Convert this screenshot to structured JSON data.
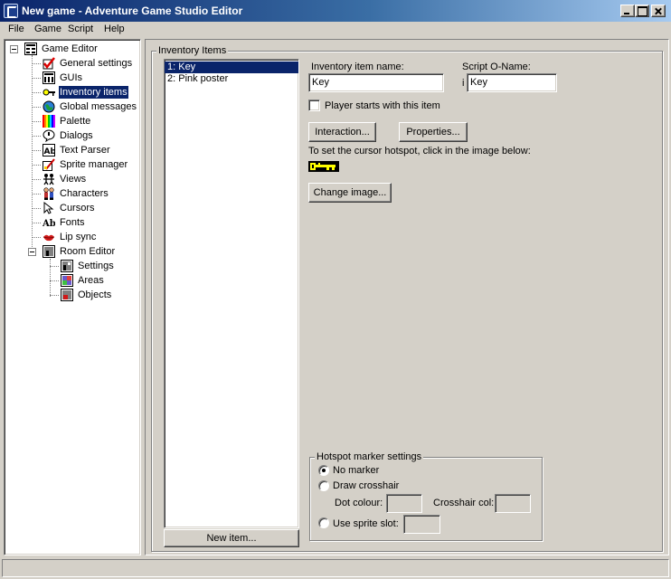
{
  "window": {
    "title": "New game - Adventure Game Studio Editor"
  },
  "menu": [
    "File",
    "Game",
    "Script",
    "Help"
  ],
  "tree": {
    "root_label": "Game Editor",
    "items": [
      {
        "label": "General settings",
        "icon": "checkmark-icon"
      },
      {
        "label": "GUIs",
        "icon": "gui-icon"
      },
      {
        "label": "Inventory items",
        "icon": "key-icon"
      },
      {
        "label": "Global messages",
        "icon": "globe-icon"
      },
      {
        "label": "Palette",
        "icon": "palette-icon"
      },
      {
        "label": "Dialogs",
        "icon": "dialog-icon"
      },
      {
        "label": "Text Parser",
        "icon": "text-parser-icon"
      },
      {
        "label": "Sprite manager",
        "icon": "sprite-icon"
      },
      {
        "label": "Views",
        "icon": "views-icon"
      },
      {
        "label": "Characters",
        "icon": "characters-icon"
      },
      {
        "label": "Cursors",
        "icon": "cursor-icon"
      },
      {
        "label": "Fonts",
        "icon": "font-icon"
      },
      {
        "label": "Lip sync",
        "icon": "lips-icon"
      }
    ],
    "selected": "Inventory items",
    "room_label": "Room Editor",
    "room_items": [
      {
        "label": "Settings",
        "icon": "room-settings-icon"
      },
      {
        "label": "Areas",
        "icon": "room-areas-icon"
      },
      {
        "label": "Objects",
        "icon": "room-objects-icon"
      }
    ]
  },
  "inventory": {
    "group_title": "Inventory Items",
    "list": [
      "1: Key",
      "2: Pink poster"
    ],
    "new_item_label": "New item...",
    "name_label": "Inventory item name:",
    "name_value": "Key",
    "script_label": "Script O-Name:",
    "script_prefix": "i",
    "script_value": "Key",
    "player_starts_label": "Player starts with this item",
    "interaction_label": "Interaction...",
    "properties_label": "Properties...",
    "hotspot_hint": "To set the cursor hotspot, click in the image below:",
    "change_image_label": "Change image..."
  },
  "hotspot": {
    "group_title": "Hotspot marker settings",
    "no_marker": "No marker",
    "draw_crosshair": "Draw crosshair",
    "dot_colour": "Dot colour:",
    "crosshair_col": "Crosshair col:",
    "use_sprite": "Use sprite slot:",
    "selected": "No marker"
  },
  "colors": {
    "title_start": "#0a246a",
    "title_end": "#a6caf0",
    "selection": "#0a246a",
    "key_yellow": "#ffff00"
  }
}
